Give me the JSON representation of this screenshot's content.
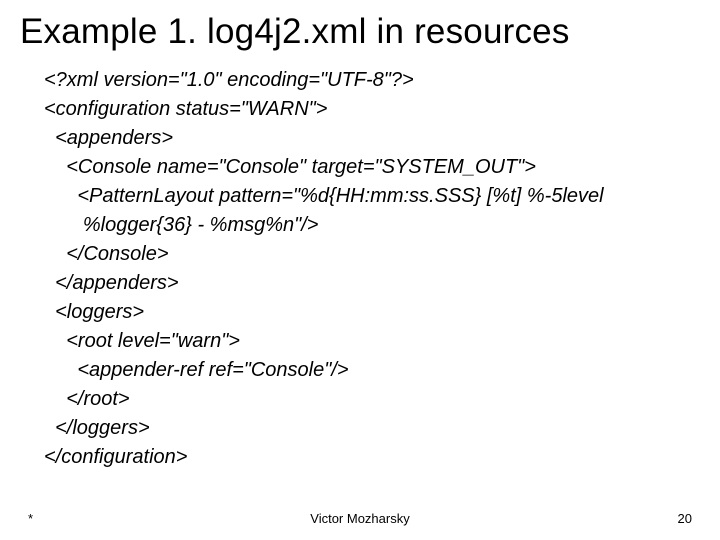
{
  "title": "Example 1. log4j2.xml in resources",
  "code": {
    "l1": "<?xml version=\"1.0\" encoding=\"UTF-8\"?>",
    "l2": "<configuration status=\"WARN\">",
    "l3": "  <appenders>",
    "l4": "    <Console name=\"Console\" target=\"SYSTEM_OUT\">",
    "l5": "      <PatternLayout pattern=\"%d{HH:mm:ss.SSS} [%t] %-5level",
    "l6": "       %logger{36} - %msg%n\"/>",
    "l7": "    </Console>",
    "l8": "  </appenders>",
    "l9": "  <loggers>",
    "l10": "    <root level=\"warn\">",
    "l11": "      <appender-ref ref=\"Console\"/>",
    "l12": "    </root>",
    "l13": "  </loggers>",
    "l14": "</configuration>"
  },
  "footer": {
    "left": "*",
    "center": "Victor Mozharsky",
    "right": "20"
  }
}
